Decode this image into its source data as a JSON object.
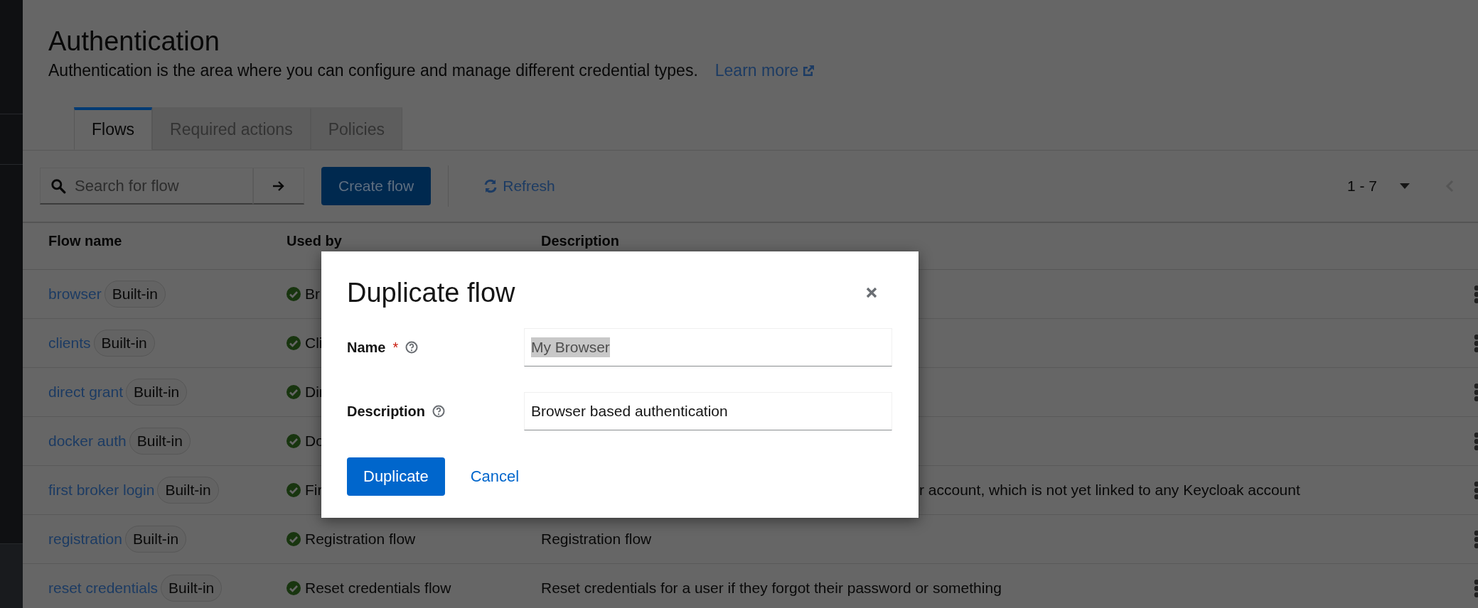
{
  "page": {
    "title": "Authentication",
    "description": "Authentication is the area where you can configure and manage different credential types.",
    "learn_more": "Learn more"
  },
  "tabs": [
    {
      "label": "Flows",
      "selected": true
    },
    {
      "label": "Required actions",
      "selected": false
    },
    {
      "label": "Policies",
      "selected": false
    }
  ],
  "toolbar": {
    "search": {
      "placeholder": "Search for flow"
    },
    "create_button": "Create flow",
    "refresh": "Refresh",
    "pagination": "1 - 7"
  },
  "table": {
    "columns": [
      "Flow name",
      "Used by",
      "Description"
    ],
    "rows": [
      {
        "name": "browser",
        "badge": "Built-in",
        "used_by": "Br"
      },
      {
        "name": "clients",
        "badge": "Built-in",
        "used_by": "Cli"
      },
      {
        "name": "direct grant",
        "badge": "Built-in",
        "used_by": "Dir"
      },
      {
        "name": "docker auth",
        "badge": "Built-in",
        "used_by": "Do"
      },
      {
        "name": "first broker login",
        "badge": "Built-in",
        "used_by": "Fir",
        "description": "r account, which is not yet linked to any Keycloak account",
        "description_partial": true
      },
      {
        "name": "registration",
        "badge": "Built-in",
        "used_by": "Registration flow",
        "description": "Registration flow",
        "description_partial": false
      },
      {
        "name": "reset credentials",
        "badge": "Built-in",
        "used_by": "Reset credentials flow",
        "description": "Reset credentials for a user if they forgot their password or something",
        "description_partial": false
      }
    ]
  },
  "modal": {
    "title": "Duplicate flow",
    "fields": [
      {
        "label": "Name",
        "required_mark": "*",
        "value": "My Browser",
        "selected_text": true
      },
      {
        "label": "Description",
        "value": "Browser based authentication",
        "selected_text": false
      }
    ],
    "primary_button": "Duplicate",
    "cancel_link": "Cancel"
  }
}
